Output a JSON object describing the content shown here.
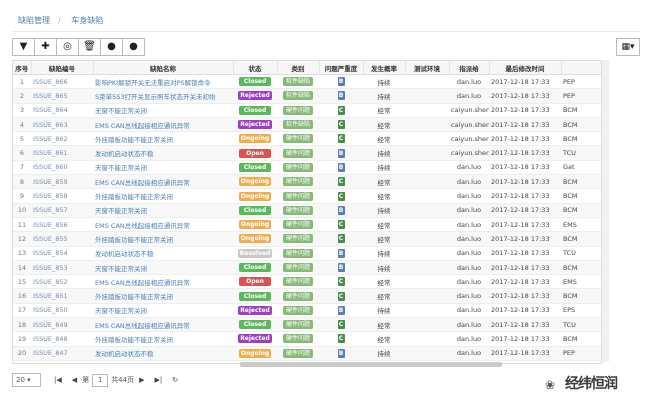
{
  "breadcrumb": [
    "缺陷管理",
    "车身缺陷"
  ],
  "toolbar": {
    "buttons": [
      "filter-icon",
      "add-icon",
      "view-icon",
      "delete-icon",
      "info-icon",
      "export-icon"
    ],
    "button_glyphs": [
      "▼",
      "✚",
      "◎",
      "🗑",
      "●",
      "●"
    ],
    "grid_menu_glyph": "▦▾"
  },
  "columns": [
    "序号",
    "缺陷编号",
    "缺陷名称",
    "状态",
    "类别",
    "问题严重度",
    "发生概率",
    "测试环境",
    "指派给",
    "最后修改时间",
    ""
  ],
  "status_colors": {
    "Closed": "#5cb85c",
    "Rejected": "#9b3fc6",
    "Ongoing": "#f0ad4e",
    "Open": "#d9534f",
    "Resolved": "#c9c9c9"
  },
  "severity_colors": {
    "B": "#5a7fb0",
    "C": "#4a8c4a"
  },
  "rows": [
    {
      "idx": "1",
      "code": "ISSUE_866",
      "name": "影响PKI解锁开关无法重启对PS解锁命令",
      "status": "Closed",
      "cat": "软件缺陷",
      "sev": "B",
      "prob": "持续",
      "env": "",
      "assignee": "dan.luo",
      "time": "2017-12-18 17:33",
      "extra": "PEP"
    },
    {
      "idx": "2",
      "code": "ISSUE_865",
      "name": "S菜单5S3打开关显示照车状态开关未初始",
      "status": "Rejected",
      "cat": "软件缺陷",
      "sev": "B",
      "prob": "持续",
      "env": "",
      "assignee": "dan.luo",
      "time": "2017-12-18 17:33",
      "extra": "PEP"
    },
    {
      "idx": "3",
      "code": "ISSUE_864",
      "name": "无窗不能正常关闭",
      "status": "Closed",
      "cat": "硬件问题",
      "sev": "C",
      "prob": "经常",
      "env": "",
      "assignee": "caiyun.shen",
      "time": "2017-12-18 17:33",
      "extra": "BCM"
    },
    {
      "idx": "4",
      "code": "ISSUE_863",
      "name": "EMS CAN总线起接相应通讯异常",
      "status": "Rejected",
      "cat": "软件缺陷",
      "sev": "C",
      "prob": "经常",
      "env": "",
      "assignee": "caiyun.shen",
      "time": "2017-12-18 17:33",
      "extra": "BCM"
    },
    {
      "idx": "5",
      "code": "ISSUE_862",
      "name": "外挂踏板功能不能正常关闭",
      "status": "Ongoing",
      "cat": "硬件问题",
      "sev": "C",
      "prob": "经常",
      "env": "",
      "assignee": "caiyun.shen",
      "time": "2017-12-18 17:33",
      "extra": "BCM"
    },
    {
      "idx": "6",
      "code": "ISSUE_861",
      "name": "发动机启动状态不稳",
      "status": "Open",
      "cat": "硬件问题",
      "sev": "B",
      "prob": "持续",
      "env": "",
      "assignee": "caiyun.shen",
      "time": "2017-12-18 17:33",
      "extra": "TCU"
    },
    {
      "idx": "7",
      "code": "ISSUE_860",
      "name": "天窗不能正常关闭",
      "status": "Closed",
      "cat": "硬件问题",
      "sev": "B",
      "prob": "持续",
      "env": "",
      "assignee": "dan.luo",
      "time": "2017-12-18 17:33",
      "extra": "Gat"
    },
    {
      "idx": "8",
      "code": "ISSUE_859",
      "name": "EMS CAN总线起接相应通讯异常",
      "status": "Ongoing",
      "cat": "硬件问题",
      "sev": "C",
      "prob": "经常",
      "env": "",
      "assignee": "dan.luo",
      "time": "2017-12-18 17:33",
      "extra": "BCM"
    },
    {
      "idx": "9",
      "code": "ISSUE_858",
      "name": "外挂踏板功能不能正常关闭",
      "status": "Ongoing",
      "cat": "硬件问题",
      "sev": "C",
      "prob": "经常",
      "env": "",
      "assignee": "dan.luo",
      "time": "2017-12-18 17:33",
      "extra": "BCM"
    },
    {
      "idx": "10",
      "code": "ISSUE_857",
      "name": "天窗不能正常关闭",
      "status": "Closed",
      "cat": "硬件问题",
      "sev": "B",
      "prob": "持续",
      "env": "",
      "assignee": "dan.luo",
      "time": "2017-12-18 17:33",
      "extra": "BCM"
    },
    {
      "idx": "11",
      "code": "ISSUE_856",
      "name": "EMS CAN总线起接相应通讯异常",
      "status": "Ongoing",
      "cat": "硬件问题",
      "sev": "C",
      "prob": "经常",
      "env": "",
      "assignee": "dan.luo",
      "time": "2017-12-18 17:33",
      "extra": "EMS"
    },
    {
      "idx": "12",
      "code": "ISSUE_855",
      "name": "外挂踏板功能不能正常关闭",
      "status": "Ongoing",
      "cat": "硬件问题",
      "sev": "C",
      "prob": "经常",
      "env": "",
      "assignee": "dan.luo",
      "time": "2017-12-18 17:33",
      "extra": "BCM"
    },
    {
      "idx": "13",
      "code": "ISSUE_854",
      "name": "发动机启动状态不稳",
      "status": "Resolved",
      "cat": "硬件问题",
      "sev": "B",
      "prob": "持续",
      "env": "",
      "assignee": "dan.luo",
      "time": "2017-12-18 17:33",
      "extra": "TCU"
    },
    {
      "idx": "14",
      "code": "ISSUE_853",
      "name": "天窗不能正常关闭",
      "status": "Closed",
      "cat": "硬件问题",
      "sev": "B",
      "prob": "持续",
      "env": "",
      "assignee": "dan.luo",
      "time": "2017-12-18 17:33",
      "extra": "BCM"
    },
    {
      "idx": "15",
      "code": "ISSUE_852",
      "name": "EMS CAN总线起接相应通讯异常",
      "status": "Open",
      "cat": "硬件问题",
      "sev": "C",
      "prob": "经常",
      "env": "",
      "assignee": "dan.luo",
      "time": "2017-12-18 17:33",
      "extra": "EMS"
    },
    {
      "idx": "16",
      "code": "ISSUE_851",
      "name": "外挂踏板功能不能正常关闭",
      "status": "Closed",
      "cat": "硬件问题",
      "sev": "C",
      "prob": "经常",
      "env": "",
      "assignee": "dan.luo",
      "time": "2017-12-18 17:33",
      "extra": "BCM"
    },
    {
      "idx": "17",
      "code": "ISSUE_850",
      "name": "天窗不能正常关闭",
      "status": "Rejected",
      "cat": "硬件问题",
      "sev": "B",
      "prob": "持续",
      "env": "",
      "assignee": "dan.luo",
      "time": "2017-12-18 17:33",
      "extra": "EPS"
    },
    {
      "idx": "18",
      "code": "ISSUE_849",
      "name": "EMS CAN总线起接相应通讯异常",
      "status": "Closed",
      "cat": "硬件问题",
      "sev": "C",
      "prob": "经常",
      "env": "",
      "assignee": "dan.luo",
      "time": "2017-12-18 17:33",
      "extra": "TCU"
    },
    {
      "idx": "19",
      "code": "ISSUE_848",
      "name": "外挂踏板功能不能正常关闭",
      "status": "Rejected",
      "cat": "硬件问题",
      "sev": "C",
      "prob": "经常",
      "env": "",
      "assignee": "dan.luo",
      "time": "2017-12-18 17:33",
      "extra": "BCM"
    },
    {
      "idx": "20",
      "code": "ISSUE_847",
      "name": "发动机启动状态不稳",
      "status": "Ongoing",
      "cat": "硬件问题",
      "sev": "B",
      "prob": "持续",
      "env": "",
      "assignee": "dan.luo",
      "time": "2017-12-18 17:33",
      "extra": "PEP"
    }
  ],
  "footer": {
    "page_size": "20",
    "page_prefix": "第",
    "page": "1",
    "page_total": "共44页"
  },
  "watermark": {
    "text": "经纬恒润"
  }
}
